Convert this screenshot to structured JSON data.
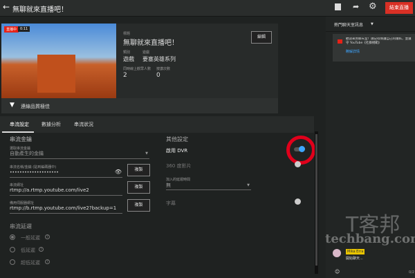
{
  "header": {
    "title": "無聊就來直播吧！",
    "end_button": "結束直播"
  },
  "preview": {
    "live_badge": "直播中",
    "duration": "0:11",
    "connection": "連線品質極佳"
  },
  "info": {
    "title_label": "標題",
    "title": "無聊就來直播吧！",
    "category_label": "類別",
    "category": "遊戲",
    "game_label": "遊戲",
    "game": "要塞英雄系列",
    "viewers_label": "同時線上觀眾人數",
    "viewers": "2",
    "likes_label": "按讚次數",
    "likes": "0",
    "edit_button": "編輯"
  },
  "tabs": [
    "串流設定",
    "數據分析",
    "串流狀況"
  ],
  "stream_key": {
    "heading": "串流金鑰",
    "select_label": "選取串流金鑰",
    "select_value": "自動產生的金鑰",
    "key_label": "串流名稱/金鑰 (貼到編碼器中)",
    "key_value": "••••••••••••••••••••",
    "url_label": "串流網址",
    "url_value": "rtmp://a.rtmp.youtube.com/live2",
    "backup_label": "備用伺服器網址",
    "backup_value": "rtmp://b.rtmp.youtube.com/live2?backup=1",
    "copy": "複製"
  },
  "latency": {
    "heading": "串流延遲",
    "options": [
      "一般延遲",
      "低延遲",
      "超低延遲"
    ],
    "selected": 0
  },
  "other": {
    "heading": "其他設定",
    "dvr": "啟用 DVR",
    "dvr_on": true,
    "vr360": "360 度影片",
    "vr360_on": false,
    "delay_label": "加入的延遲時間",
    "delay_value": "無",
    "captions": "字幕",
    "captions_on": false
  },
  "chat": {
    "mode": "熱門聊天室訊息",
    "notice": "歡迎來到聊天室！請記得保護自己的隱私，並遵守 YouTube《社群規範》",
    "learn_more": "瞭解詳情",
    "user": "Mika Erra",
    "message": "開始聊天...",
    "counter": "0/2"
  },
  "colors": {
    "accent": "#3ea6ff",
    "end": "#d93025",
    "highlight": "#ff0000"
  },
  "watermark": "techbang.com T客邦"
}
